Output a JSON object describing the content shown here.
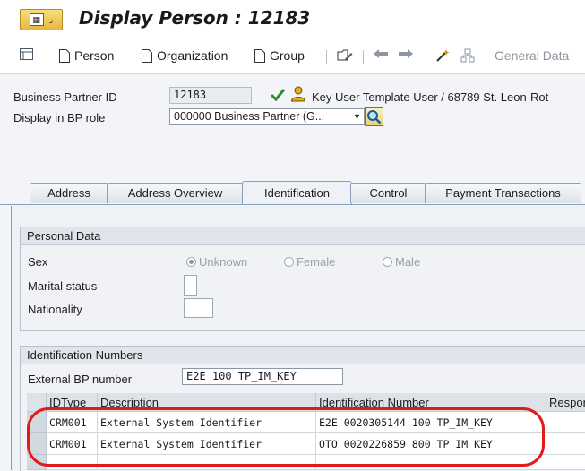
{
  "window": {
    "title": "Display Person : 12183"
  },
  "toolbar": {
    "person_label": "Person",
    "organization_label": "Organization",
    "group_label": "Group",
    "general_data_label": "General Data"
  },
  "header": {
    "bp_id_label": "Business Partner ID",
    "bp_id_value": "12183",
    "bp_description": "Key User Template User / 68789 St. Leon-Rot",
    "role_label": "Display in BP role",
    "role_value": "000000 Business Partner (G..."
  },
  "tabs": [
    {
      "label": "Address",
      "active": false
    },
    {
      "label": "Address Overview",
      "active": false
    },
    {
      "label": "Identification",
      "active": true
    },
    {
      "label": "Control",
      "active": false
    },
    {
      "label": "Payment Transactions",
      "active": false
    }
  ],
  "personal_data": {
    "title": "Personal Data",
    "sex_label": "Sex",
    "sex_options": [
      "Unknown",
      "Female",
      "Male"
    ],
    "sex_selected": "Unknown",
    "marital_label": "Marital status",
    "nationality_label": "Nationality"
  },
  "identification_numbers": {
    "title": "Identification Numbers",
    "external_bp_label": "External BP number",
    "external_bp_value": "E2E 100 TP_IM_KEY",
    "columns": [
      "IDType",
      "Description",
      "Identification Number",
      "Respon"
    ],
    "rows": [
      {
        "idtype": "CRM001",
        "description": "External System Identifier",
        "number": "E2E 0020305144 100 TP_IM_KEY"
      },
      {
        "idtype": "CRM001",
        "description": "External System Identifier",
        "number": "OTO 0020226859 800 TP_IM_KEY"
      }
    ]
  },
  "colors": {
    "highlight": "#e01b1b",
    "accent_yellow": "#e8b83d",
    "check_green": "#2e8b2e"
  },
  "icons": [
    "menu-icon",
    "details-icon",
    "document-icon",
    "pencil-toggle-icon",
    "back-arrow-icon",
    "forward-arrow-icon",
    "check-icon",
    "user-icon",
    "search-icon"
  ]
}
